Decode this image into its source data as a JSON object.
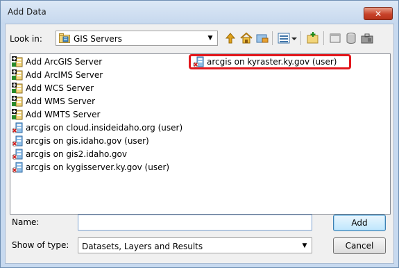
{
  "window": {
    "title": "Add Data",
    "close_symbol": "✕"
  },
  "look_in": {
    "label": "Look in:",
    "value": "GIS Servers",
    "icon": "gis-servers-folder-icon"
  },
  "toolbar": {
    "icons": [
      "up-one-level-icon",
      "home-icon",
      "connect-folder-icon",
      "list-view-icon",
      "view-dropdown-icon",
      "new-folder-icon",
      "catalog-icon",
      "database-icon",
      "toolbox-icon"
    ]
  },
  "list": {
    "items": [
      {
        "label": "Add ArcGIS Server",
        "icon": "add-server-icon"
      },
      {
        "label": "Add ArcIMS Server",
        "icon": "add-server-icon"
      },
      {
        "label": "Add WCS Server",
        "icon": "add-server-icon"
      },
      {
        "label": "Add WMS Server",
        "icon": "add-server-icon"
      },
      {
        "label": "Add WMTS Server",
        "icon": "add-server-icon"
      },
      {
        "label": "arcgis on cloud.insideidaho.org (user)",
        "icon": "disconnected-server-icon"
      },
      {
        "label": "arcgis on gis.idaho.gov (user)",
        "icon": "disconnected-server-icon"
      },
      {
        "label": "arcgis on gis2.idaho.gov",
        "icon": "disconnected-server-icon"
      },
      {
        "label": "arcgis on kygisserver.ky.gov (user)",
        "icon": "disconnected-server-icon"
      },
      {
        "label": "arcgis on kyraster.ky.gov (user)",
        "icon": "disconnected-server-icon",
        "highlighted": true
      }
    ]
  },
  "name_field": {
    "label": "Name:",
    "value": ""
  },
  "type_field": {
    "label": "Show of type:",
    "value": "Datasets, Layers and Results"
  },
  "buttons": {
    "add": "Add",
    "cancel": "Cancel"
  },
  "colors": {
    "highlight_border": "#e2171c",
    "close_button": "#c8432a"
  }
}
